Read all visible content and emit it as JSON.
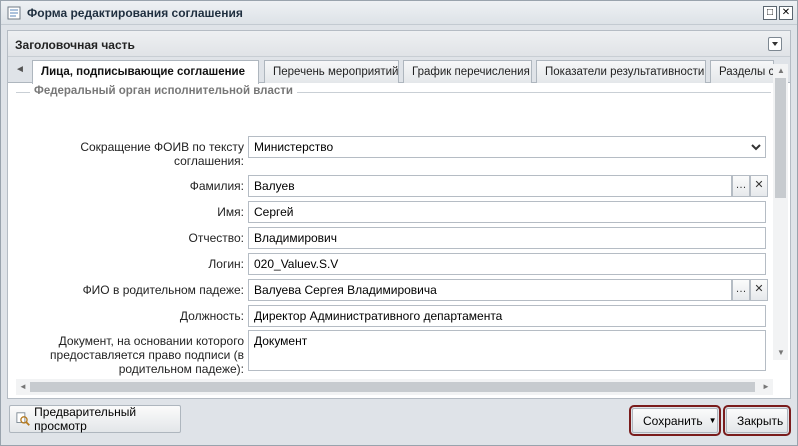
{
  "window": {
    "title": "Форма редактирования соглашения",
    "min_glyph": "□",
    "close_glyph": "✕",
    "icon": "form-icon"
  },
  "panel": {
    "title": "Заголовочная часть",
    "collapse_icon": "chevron-down-icon"
  },
  "tabs": [
    {
      "label": "Лица, подписывающие соглашение",
      "active": true
    },
    {
      "label": "Перечень мероприятий",
      "active": false
    },
    {
      "label": "График перечисления",
      "active": false
    },
    {
      "label": "Показатели результативности",
      "active": false
    },
    {
      "label": "Разделы со",
      "active": false
    }
  ],
  "tab_scroll_left": "◄",
  "section": {
    "legend": "Федеральный орган исполнительной власти"
  },
  "fields": {
    "foiv": {
      "label": "Сокращение ФОИВ по тексту соглашения:",
      "value": "Министерство"
    },
    "surname": {
      "label": "Фамилия:",
      "value": "Валуев"
    },
    "name": {
      "label": "Имя:",
      "value": "Сергей"
    },
    "patronymic": {
      "label": "Отчество:",
      "value": "Владимирович"
    },
    "login": {
      "label": "Логин:",
      "value": "020_Valuev.S.V"
    },
    "fio_genitive": {
      "label": "ФИО в родительном падеже:",
      "value": "Валуева Сергея Владимировича"
    },
    "position": {
      "label": "Должность:",
      "value": "Директор Административного департамента"
    },
    "document": {
      "label": "Документ, на основании которого предоставляется право подписи (в родительном падеже):",
      "value": "Документ"
    }
  },
  "select_btn": "…",
  "clear_btn": "✕",
  "footer": {
    "preview": "Предварительный просмотр",
    "save": "Сохранить",
    "close": "Закрыть"
  },
  "colors": {
    "save_icon": "#3aa537",
    "close_icon": "#d9383a",
    "highlight": "#7a1c1c"
  }
}
